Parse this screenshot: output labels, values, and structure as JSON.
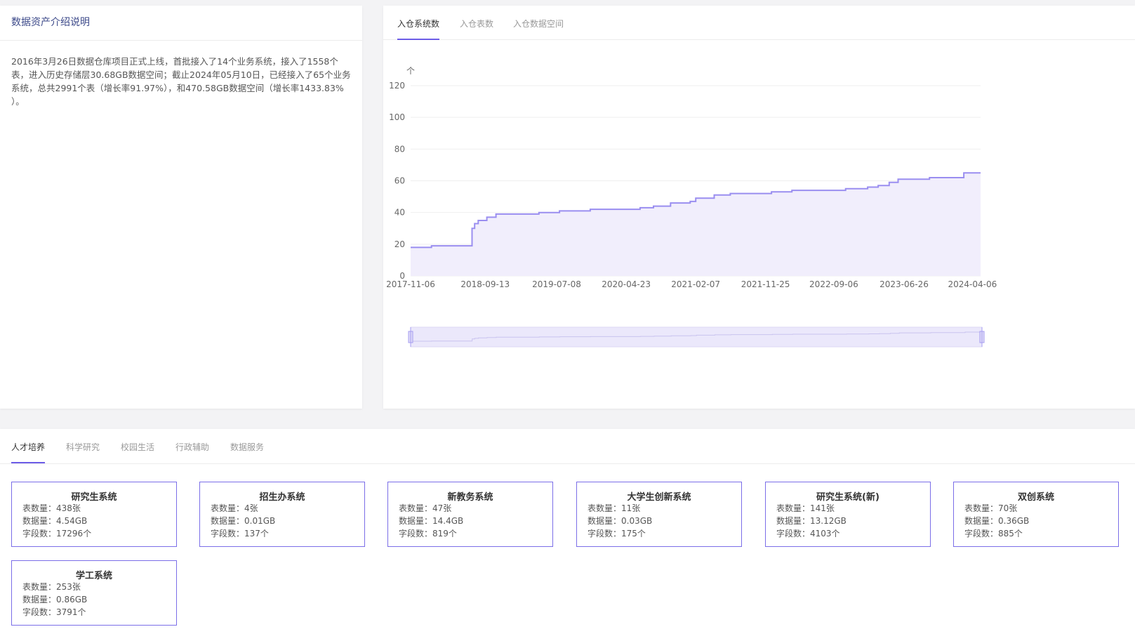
{
  "intro": {
    "title": "数据资产介绍说明",
    "text": "2016年3月26日数据仓库项目正式上线，首批接入了14个业务系统，接入了1558个表，进入历史存储层30.68GB数据空间；截止2024年05月10日，已经接入了65个业务系统，总共2991个表（增长率91.97%），和470.58GB数据空间（增长率1433.83% ）。"
  },
  "chart_tabs": [
    "入仓系统数",
    "入仓表数",
    "入仓数据空间"
  ],
  "system_tabs": [
    "人才培养",
    "科学研究",
    "校园生活",
    "行政辅助",
    "数据服务"
  ],
  "labels": {
    "tables": "表数量：",
    "data": "数据量：",
    "fields": "字段数："
  },
  "colors": {
    "accent": "#6c5ce7",
    "line": "#9a8ef0",
    "area": "#f1eefc",
    "box_border": "#7b6ee8"
  },
  "systems": [
    {
      "name": "研究生系统",
      "tables": "438张",
      "data": "4.54GB",
      "fields": "17296个"
    },
    {
      "name": "招生办系统",
      "tables": "4张",
      "data": "0.01GB",
      "fields": "137个"
    },
    {
      "name": "新教务系统",
      "tables": "47张",
      "data": "14.4GB",
      "fields": "819个"
    },
    {
      "name": "大学生创新系统",
      "tables": "11张",
      "data": "0.03GB",
      "fields": "175个"
    },
    {
      "name": "研究生系统(新)",
      "tables": "141张",
      "data": "13.12GB",
      "fields": "4103个"
    },
    {
      "name": "双创系统",
      "tables": "70张",
      "data": "0.36GB",
      "fields": "885个"
    },
    {
      "name": "学工系统",
      "tables": "253张",
      "data": "0.86GB",
      "fields": "3791个"
    }
  ],
  "chart_data": {
    "type": "area",
    "ylabel": "个",
    "ylim": [
      0,
      120
    ],
    "yticks": [
      0,
      20,
      40,
      60,
      80,
      100,
      120
    ],
    "xrange": [
      "2017-11-06",
      "2024-05-10"
    ],
    "xtick_labels": [
      "2017-11-06",
      "2018-09-13",
      "2019-07-08",
      "2020-04-23",
      "2021-02-07",
      "2021-11-25",
      "2022-09-06",
      "2023-06-26",
      "2024-04-06"
    ],
    "grid": true,
    "has_data_zoom": true,
    "series": [
      {
        "x": [
          "2017-11-06",
          "2018-02-01",
          "2018-07-20",
          "2018-07-31",
          "2018-08-15",
          "2018-09-20",
          "2018-10-28",
          "2019-04-25",
          "2019-06-25",
          "2019-07-20",
          "2019-09-25",
          "2019-11-25",
          "2020-04-23",
          "2020-06-20",
          "2020-08-15",
          "2020-10-25",
          "2021-01-15",
          "2021-02-07",
          "2021-04-25",
          "2021-06-25",
          "2021-07-01",
          "2021-12-20",
          "2022-03-15",
          "2022-08-25",
          "2022-10-25",
          "2023-01-25",
          "2023-03-10",
          "2023-04-25",
          "2023-06-01",
          "2023-08-20",
          "2023-10-10",
          "2024-01-28",
          "2024-03-01",
          "2024-05-10"
        ],
        "y": [
          18,
          19,
          30,
          33,
          35,
          37,
          39,
          40,
          40,
          41,
          41,
          42,
          42,
          43,
          44,
          46,
          47,
          49,
          51,
          51,
          52,
          53,
          54,
          54,
          55,
          56,
          57,
          59,
          61,
          61,
          62,
          62,
          65,
          65
        ]
      }
    ]
  }
}
